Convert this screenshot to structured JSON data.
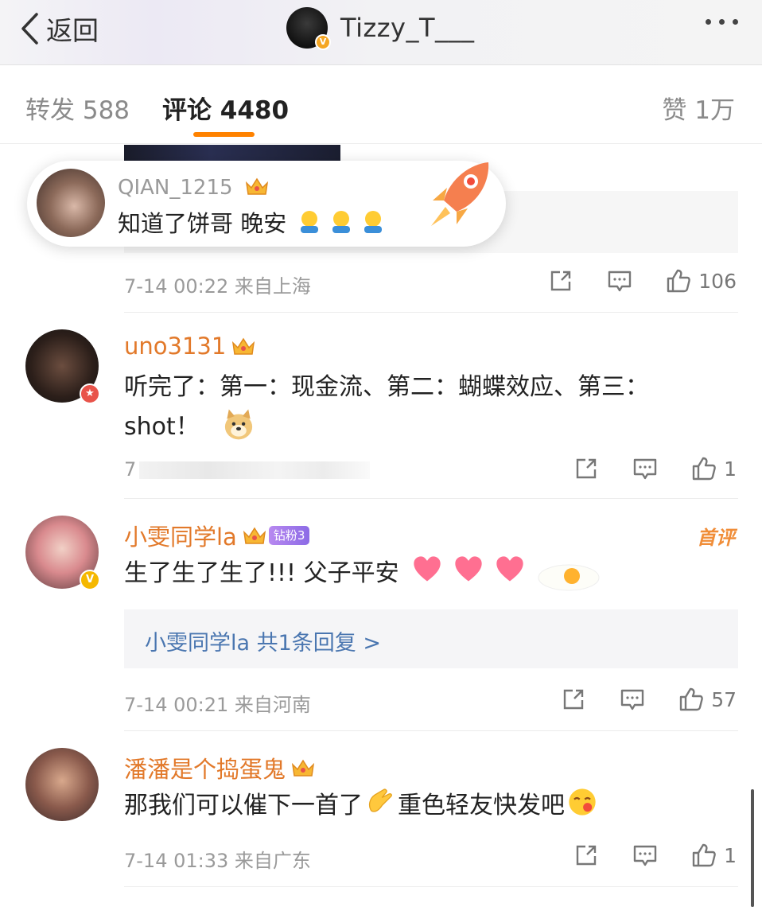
{
  "navbar": {
    "back_label": "返回",
    "username": "Tizzy_T___",
    "verified_badge": "V",
    "more_icon": "more-dots-icon"
  },
  "tabs": [
    {
      "label": "转发 588",
      "active": false
    },
    {
      "label": "评论 4480",
      "active": true
    },
    {
      "label": "赞 1万",
      "active": false
    }
  ],
  "accent_color": "#ff8200",
  "popup": {
    "username": "QIAN_1215",
    "text": "知道了饼哥 晚安",
    "emoji": [
      "hug-emoji",
      "hug-emoji",
      "hug-emoji"
    ]
  },
  "comments": [
    {
      "meta": "7-14 00:22 来自上海",
      "likes": "106"
    },
    {
      "username": "uno3131",
      "text_line1": "听完了：第一：现金流、第二：蝴蝶效应、第三：",
      "text_line2": "shot！",
      "meta": "7",
      "likes": "1"
    },
    {
      "username": "小雯同学la",
      "fan_badge": "钻粉3",
      "first_tag": "首评",
      "text": "生了生了生了!!! 父子平安",
      "reply_link": "小雯同学la  共1条回复 >",
      "meta": "7-14 00:21 来自河南",
      "likes": "57"
    },
    {
      "username": "潘潘是个捣蛋鬼",
      "text_a": "那我们可以催下一首了",
      "text_b": "重色轻友快发吧",
      "meta": "7-14 01:33 来自广东",
      "likes": "1"
    }
  ]
}
